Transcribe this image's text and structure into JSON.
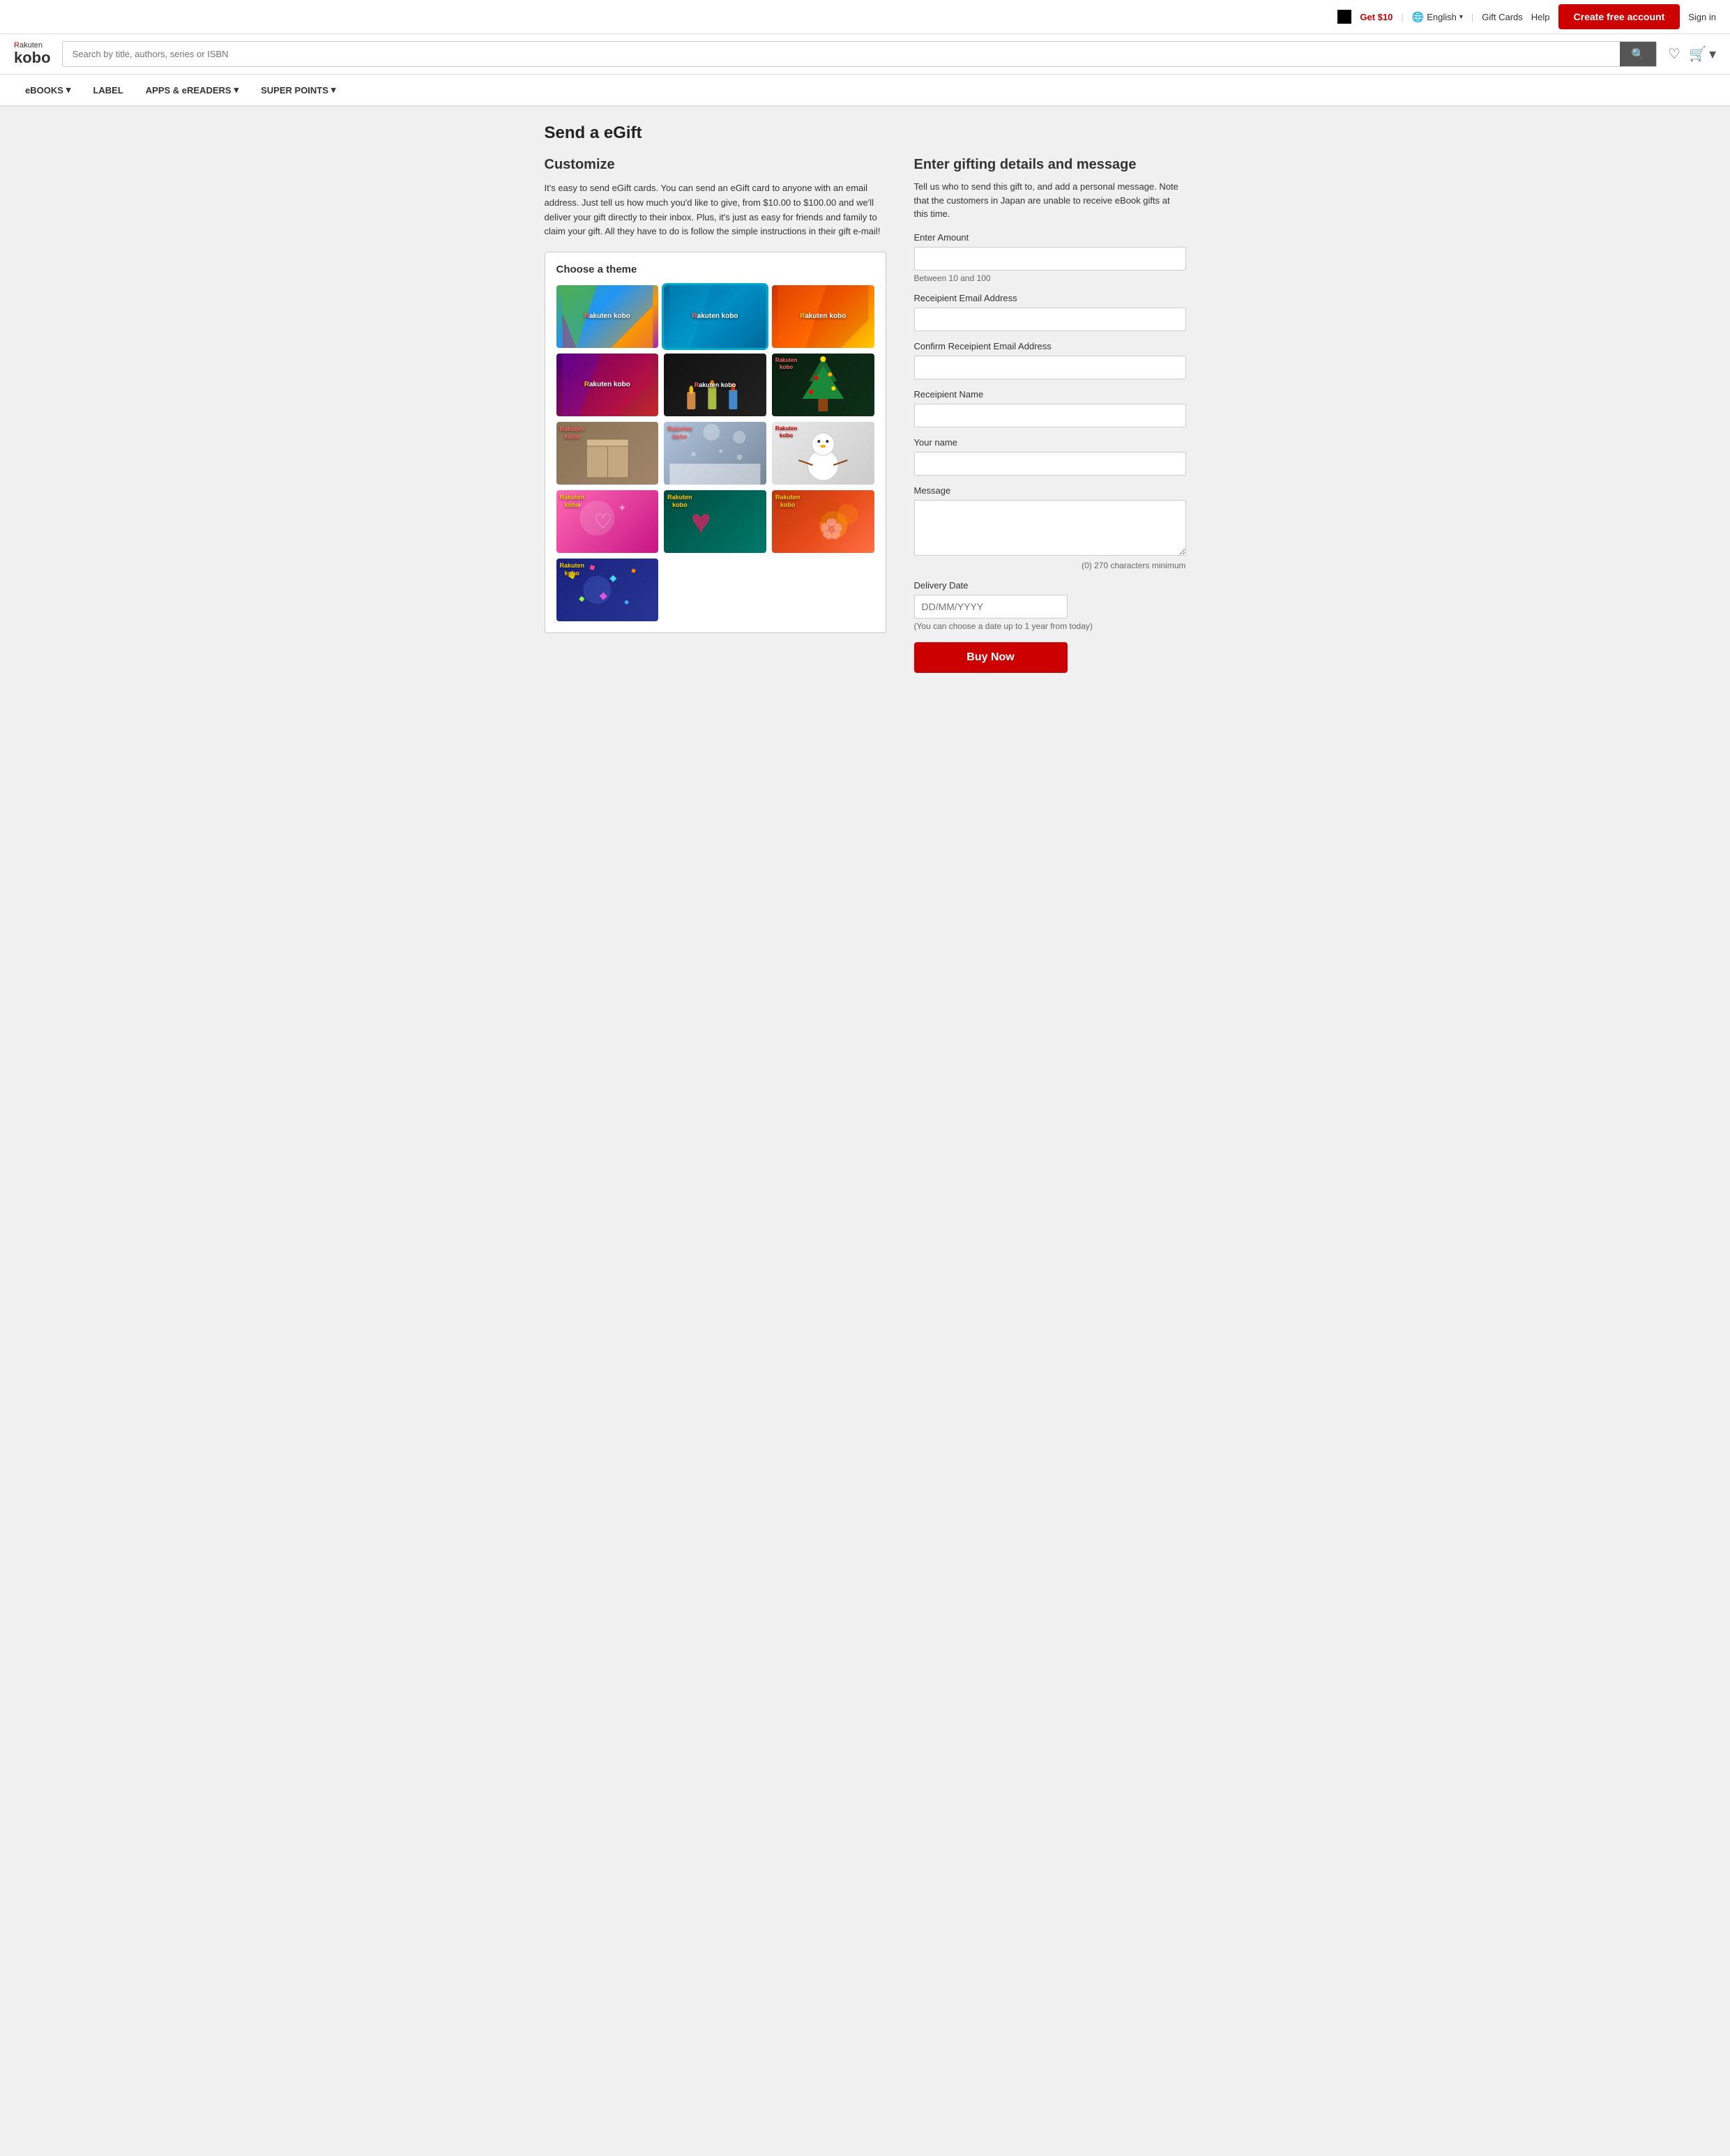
{
  "topbar": {
    "get10_label": "Get $10",
    "lang_label": "English",
    "gift_cards_label": "Gift Cards",
    "help_label": "Help",
    "create_account_label": "Create free account",
    "sign_in_label": "Sign in"
  },
  "header": {
    "logo_rakuten": "Rakuten",
    "logo_kobo": "kobo",
    "search_placeholder": "Search by title, authors, series or ISBN"
  },
  "nav": {
    "items": [
      {
        "label": "eBOOKS",
        "has_arrow": true
      },
      {
        "label": "LABEL",
        "has_arrow": false
      },
      {
        "label": "APPS & eREADERS",
        "has_arrow": true
      },
      {
        "label": "SUPER POINTS",
        "has_arrow": true
      }
    ]
  },
  "page": {
    "title": "Send a eGift",
    "customize_title": "Customize",
    "customize_desc": "It's easy to send eGift cards. You can send an eGift card to anyone with an email address. Just tell us how much you'd like to give, from $10.00 to $100.00 and we'll deliver your gift directly to their inbox. Plus, it's just as easy for friends and family to claim your gift. All they have to do is follow the simple instructions in their gift e-mail!",
    "theme_title": "Choose a theme",
    "themes": [
      {
        "id": 1,
        "bg": "linear-gradient(135deg, #4CAF50 0%, #2196F3 40%, #FF9800 70%, #9C27B0 100%)",
        "label": "Rakuten\nkobo",
        "selected": false
      },
      {
        "id": 2,
        "bg": "linear-gradient(135deg, #00BCD4 0%, #1565C0 50%, #00ACC1 100%)",
        "label": "Rakuten\nkobo",
        "selected": true
      },
      {
        "id": 3,
        "bg": "linear-gradient(135deg, #FF5722 0%, #FF9800 50%, #FFC107 100%)",
        "label": "Rakuten\nkobo",
        "selected": false
      },
      {
        "id": 4,
        "bg": "linear-gradient(135deg, #7B1FA2 0%, #E91E63 50%, #FF5722 100%)",
        "label": "Rakuten\nkobo",
        "selected": false
      },
      {
        "id": 5,
        "bg": "linear-gradient(135deg, #1a1a2e 0%, #16213e 50%, #0f3460 100%)",
        "label": "Rakuten\nkobo",
        "selected": false,
        "is_photo": true,
        "photo_type": "candles"
      },
      {
        "id": 6,
        "bg": "linear-gradient(135deg, #1b5e20 0%, #388e3c 40%, #c62828 80%, #8d2727 100%)",
        "label": "Rakuten\nkobo",
        "selected": false,
        "is_photo": true,
        "photo_type": "xmas"
      },
      {
        "id": 7,
        "bg": "linear-gradient(135deg, #795548 0%, #a1887f 50%, #d7ccc8 100%)",
        "label": "Rakuten\nkobo",
        "selected": false,
        "is_photo": true,
        "photo_type": "box"
      },
      {
        "id": 8,
        "bg": "linear-gradient(135deg, #37474f 0%, #78909c 50%, #b0bec5 100%)",
        "label": "Rakuten\nkobo",
        "selected": false,
        "is_photo": true,
        "photo_type": "winter"
      },
      {
        "id": 9,
        "bg": "linear-gradient(135deg, #f5f5f5 0%, #bdbdbd 50%, #9e9e9e 100%)",
        "label": "Rakuten\nkobo",
        "selected": false,
        "is_photo": true,
        "photo_type": "snowman"
      },
      {
        "id": 10,
        "bg": "linear-gradient(135deg, #880e4f 0%, #c2185b 50%, #e91e63 100%)",
        "label": "Rakuten\nkobo",
        "selected": false,
        "is_photo": true,
        "photo_type": "girl"
      },
      {
        "id": 11,
        "bg": "linear-gradient(135deg, #004d40 0%, #00796b 50%, #e91e63 100%)",
        "label": "Rakuten\nkobo",
        "selected": false,
        "is_photo": true,
        "photo_type": "heart"
      },
      {
        "id": 12,
        "bg": "linear-gradient(135deg, #f57f17 0%, #ff8f00 40%, #ffa000 70%, #c62828 100%)",
        "label": "Rakuten\nkobo",
        "selected": false,
        "is_photo": true,
        "photo_type": "flowers"
      },
      {
        "id": 13,
        "bg": "linear-gradient(135deg, #1a237e 0%, #283593 50%, #3949ab 100%)",
        "label": "Rakuten\nkobo",
        "selected": false,
        "is_photo": true,
        "photo_type": "party"
      }
    ],
    "form_title": "Enter gifting details and message",
    "form_desc": "Tell us who to send this gift to, and add a personal message. Note that the customers in Japan are unable to receive eBook gifts at this time.",
    "amount_label": "Enter Amount",
    "amount_hint": "Between 10 and 100",
    "recipient_email_label": "Receipient Email Address",
    "confirm_email_label": "Confirm Receipient Email Address",
    "recipient_name_label": "Receipient Name",
    "your_name_label": "Your name",
    "message_label": "Message",
    "char_count": "(0) 270 characters minimum",
    "delivery_date_label": "Delivery Date",
    "delivery_date_placeholder": "DD/MM/YYYY",
    "delivery_date_hint": "(You can choose a date up to 1 year from today)",
    "buy_btn_label": "Buy Now"
  }
}
